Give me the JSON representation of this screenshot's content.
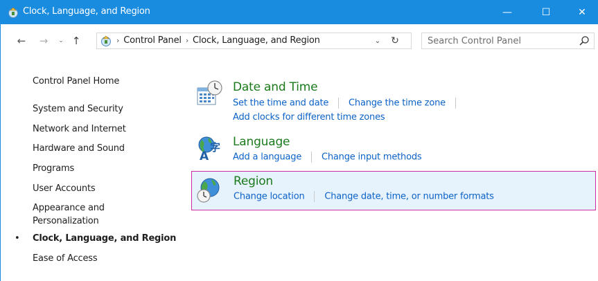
{
  "window": {
    "title": "Clock, Language, and Region",
    "minimize_glyph": "—",
    "maximize_glyph": "☐",
    "close_glyph": "✕"
  },
  "nav": {
    "back_glyph": "←",
    "forward_glyph": "→",
    "recent_glyph": "⌄",
    "up_glyph": "↑",
    "breadcrumb_sep": "›",
    "breadcrumbs": [
      "Control Panel",
      "Clock, Language, and Region"
    ],
    "dropdown_glyph": "⌄",
    "refresh_glyph": "↻"
  },
  "search": {
    "placeholder": "Search Control Panel"
  },
  "sidebar": {
    "bullet": "•",
    "items": [
      {
        "label": "Control Panel Home"
      },
      {
        "label": "System and Security"
      },
      {
        "label": "Network and Internet"
      },
      {
        "label": "Hardware and Sound"
      },
      {
        "label": "Programs"
      },
      {
        "label": "User Accounts"
      },
      {
        "label": "Appearance and"
      },
      {
        "label": "Personalization"
      },
      {
        "label": "Clock, Language, and Region"
      },
      {
        "label": "Ease of Access"
      }
    ],
    "active_item": "Clock, Language, and Region"
  },
  "categories": [
    {
      "title": "Date and Time",
      "icon": "date-time-icon",
      "links": [
        "Set the time and date",
        "Change the time zone",
        "Add clocks for different time zones"
      ]
    },
    {
      "title": "Language",
      "icon": "language-icon",
      "links": [
        "Add a language",
        "Change input methods"
      ]
    },
    {
      "title": "Region",
      "icon": "region-icon",
      "links": [
        "Change location",
        "Change date, time, or number formats"
      ]
    }
  ],
  "colors": {
    "titlebar": "#1a8ce0",
    "category_title": "#1b7a1b",
    "link": "#0b62c7",
    "highlight_bg": "#e6f2fc",
    "highlight_border": "#cc2aa0"
  }
}
